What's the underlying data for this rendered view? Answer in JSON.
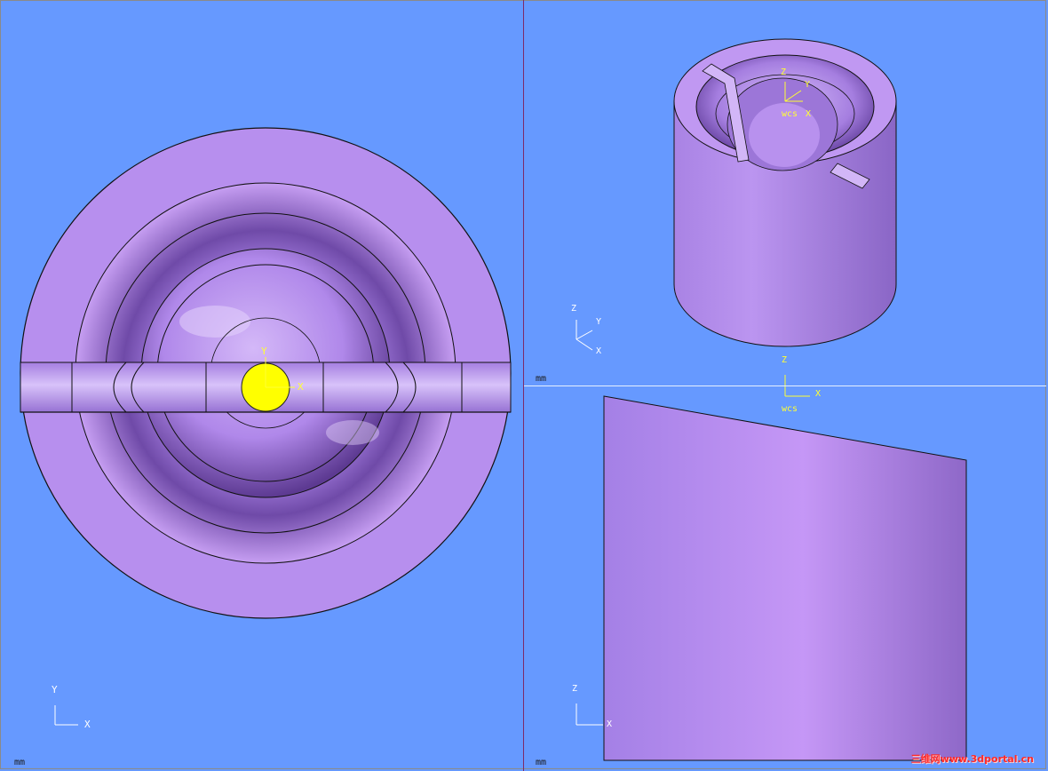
{
  "viewports": {
    "top": {
      "units": "mm",
      "triad": {
        "y": "Y",
        "x": "X"
      },
      "origin_marker": {
        "y": "Y",
        "x": "X"
      }
    },
    "iso": {
      "units": "mm",
      "triad": {
        "z": "Z",
        "y": "Y",
        "x": "X"
      },
      "wcs": {
        "label": "wcs",
        "z": "Z",
        "y": "Y",
        "x": "X"
      }
    },
    "front": {
      "units": "mm",
      "triad": {
        "z": "Z",
        "x": "X"
      }
    }
  },
  "wcs_front": {
    "label": "wcs",
    "z": "Z",
    "x": "X"
  },
  "watermark": "三维网www.3dportal.cn",
  "colors": {
    "background": "#6699ff",
    "part": "#b48cec",
    "highlight": "#ffff00",
    "wcs": "#ffff33"
  }
}
